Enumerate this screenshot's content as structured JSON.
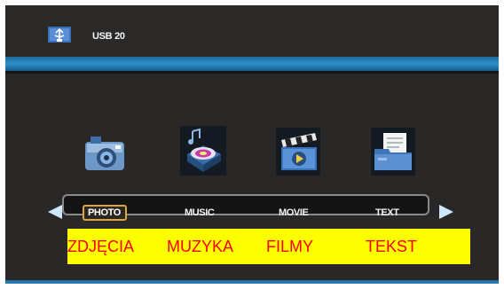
{
  "header": {
    "source_label": "USB 20",
    "icon": "usb-drive-icon"
  },
  "categories": [
    {
      "label": "PHOTO",
      "icon": "camera-icon",
      "selected": true
    },
    {
      "label": "MUSIC",
      "icon": "music-disc-icon",
      "selected": false
    },
    {
      "label": "MOVIE",
      "icon": "clapperboard-icon",
      "selected": false
    },
    {
      "label": "TEXT",
      "icon": "document-folder-icon",
      "selected": false
    }
  ],
  "translations": [
    {
      "label": "ZDJĘCIA"
    },
    {
      "label": "MUZYKA"
    },
    {
      "label": "FILMY"
    },
    {
      "label": "TEKST"
    }
  ],
  "colors": {
    "accent_blue": "#2a90c8",
    "selection": "#d9a73c",
    "caption_bg": "#ffff00",
    "caption_text": "#ff0000"
  }
}
